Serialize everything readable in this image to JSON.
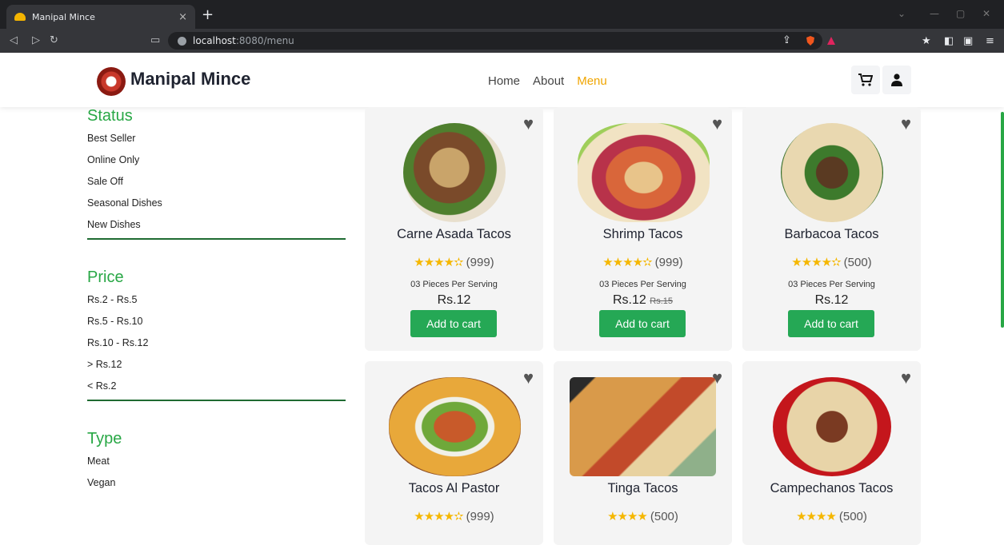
{
  "browser": {
    "tab_title": "Manipal Mince",
    "tab_close": "×",
    "new_tab": "+",
    "url_host": "localhost",
    "url_path": ":8080/menu"
  },
  "header": {
    "brand": "Manipal Mince",
    "nav": [
      "Home",
      "About",
      "Menu"
    ],
    "active_nav": "Menu"
  },
  "filters": {
    "status": {
      "title": "Status",
      "options": [
        "Best Seller",
        "Online Only",
        "Sale Off",
        "Seasonal Dishes",
        "New Dishes"
      ]
    },
    "price": {
      "title": "Price",
      "options": [
        "Rs.2 - Rs.5",
        "Rs.5 - Rs.10",
        "Rs.10 - Rs.12",
        "> Rs.12",
        "< Rs.2"
      ]
    },
    "type": {
      "title": "Type",
      "options": [
        "Meat",
        "Vegan"
      ]
    }
  },
  "products": [
    {
      "name": "Carne Asada Tacos",
      "stars": "★★★★✫",
      "reviews": "(999)",
      "serving": "03 Pieces Per Serving",
      "price": "Rs.12",
      "old_price": "",
      "cta": "Add to cart"
    },
    {
      "name": "Shrimp Tacos",
      "stars": "★★★★✫",
      "reviews": "(999)",
      "serving": "03 Pieces Per Serving",
      "price": "Rs.12",
      "old_price": "Rs.15",
      "cta": "Add to cart"
    },
    {
      "name": "Barbacoa Tacos",
      "stars": "★★★★✫",
      "reviews": "(500)",
      "serving": "03 Pieces Per Serving",
      "price": "Rs.12",
      "old_price": "",
      "cta": "Add to cart"
    },
    {
      "name": "Tacos Al Pastor",
      "stars": "★★★★✫",
      "reviews": "(999)"
    },
    {
      "name": "Tinga Tacos",
      "stars": "★★★★",
      "reviews": "(500)"
    },
    {
      "name": "Campechanos Tacos",
      "stars": "★★★★",
      "reviews": "(500)"
    }
  ],
  "colors": {
    "accent_green": "#28a745",
    "button_green": "#25a855",
    "nav_active": "#f0a500",
    "star": "#f5b700"
  }
}
